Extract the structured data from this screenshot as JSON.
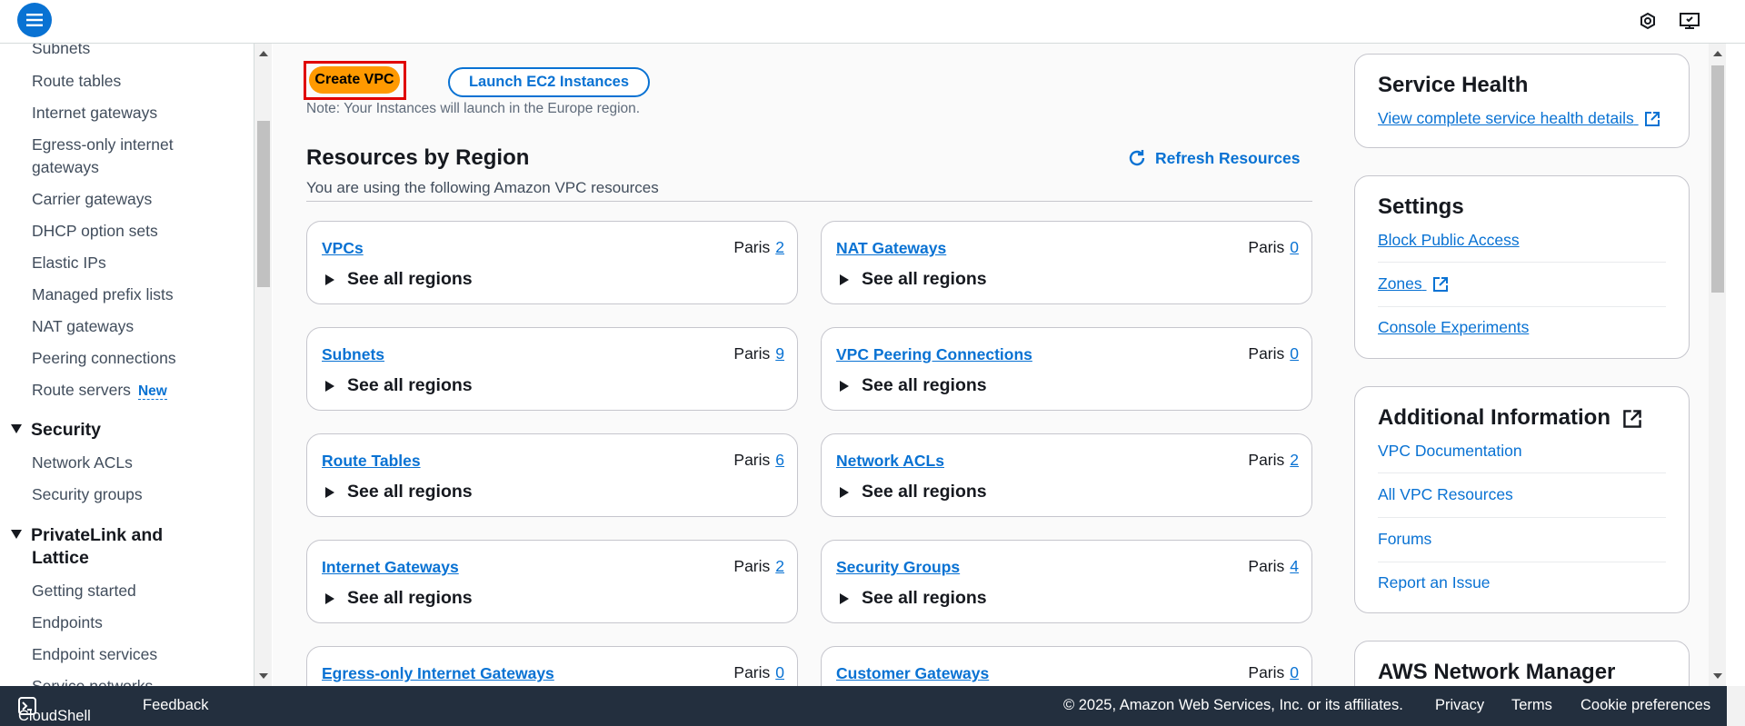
{
  "topbar": {
    "icons": [
      "menu-icon",
      "settings-hexagon-icon",
      "support-monitor-icon"
    ]
  },
  "sidebar": {
    "items_top": [
      {
        "label": "Subnets"
      },
      {
        "label": "Route tables"
      },
      {
        "label": "Internet gateways"
      },
      {
        "label": "Egress-only internet"
      },
      {
        "label": "gateways"
      },
      {
        "label": "Carrier gateways"
      },
      {
        "label": "DHCP option sets"
      },
      {
        "label": "Elastic IPs"
      },
      {
        "label": "Managed prefix lists"
      },
      {
        "label": "NAT gateways"
      },
      {
        "label": "Peering connections"
      },
      {
        "label": "Route servers"
      }
    ],
    "new_badge": "New",
    "security_section": "Security",
    "security_items": [
      "Network ACLs",
      "Security groups"
    ],
    "privatelink_section_line1": "PrivateLink and",
    "privatelink_section_line2": "Lattice",
    "privatelink_items": [
      "Getting started",
      "Endpoints",
      "Endpoint services",
      "Service networks"
    ]
  },
  "main": {
    "create_vpc": "Create VPC",
    "launch_ec2": "Launch EC2 Instances",
    "note": "Note: Your Instances will launch in the Europe region.",
    "resources_title": "Resources by Region",
    "refresh": "Refresh Resources",
    "resources_subtitle": "You are using the following Amazon VPC resources",
    "see_all": "See all regions",
    "region": "Paris",
    "cards": [
      {
        "title": "VPCs",
        "count": "2"
      },
      {
        "title": "NAT Gateways",
        "count": "0"
      },
      {
        "title": "Subnets",
        "count": "9"
      },
      {
        "title": "VPC Peering Connections",
        "count": "0"
      },
      {
        "title": "Route Tables",
        "count": "6"
      },
      {
        "title": "Network ACLs",
        "count": "2"
      },
      {
        "title": "Internet Gateways",
        "count": "2"
      },
      {
        "title": "Security Groups",
        "count": "4"
      },
      {
        "title": "Egress-only Internet Gateways",
        "count": "0"
      },
      {
        "title": "Customer Gateways",
        "count": "0"
      }
    ]
  },
  "panels": {
    "service_health": {
      "title": "Service Health",
      "link": "View complete service health details"
    },
    "settings": {
      "title": "Settings",
      "links": [
        "Block Public Access",
        "Zones",
        "Console Experiments"
      ]
    },
    "additional": {
      "title": "Additional Information",
      "links": [
        "VPC Documentation",
        "All VPC Resources",
        "Forums",
        "Report an Issue"
      ]
    },
    "network_manager": {
      "title": "AWS Network Manager"
    }
  },
  "footer": {
    "cloudshell": "CloudShell",
    "feedback": "Feedback",
    "copyright": "© 2025, Amazon Web Services, Inc. or its affiliates.",
    "privacy": "Privacy",
    "terms": "Terms",
    "cookies": "Cookie preferences"
  },
  "colors": {
    "accent": "#0972d3",
    "primary_button": "#ff9900",
    "footer_bg": "#232f3e",
    "focus_outline": "#e00000"
  }
}
